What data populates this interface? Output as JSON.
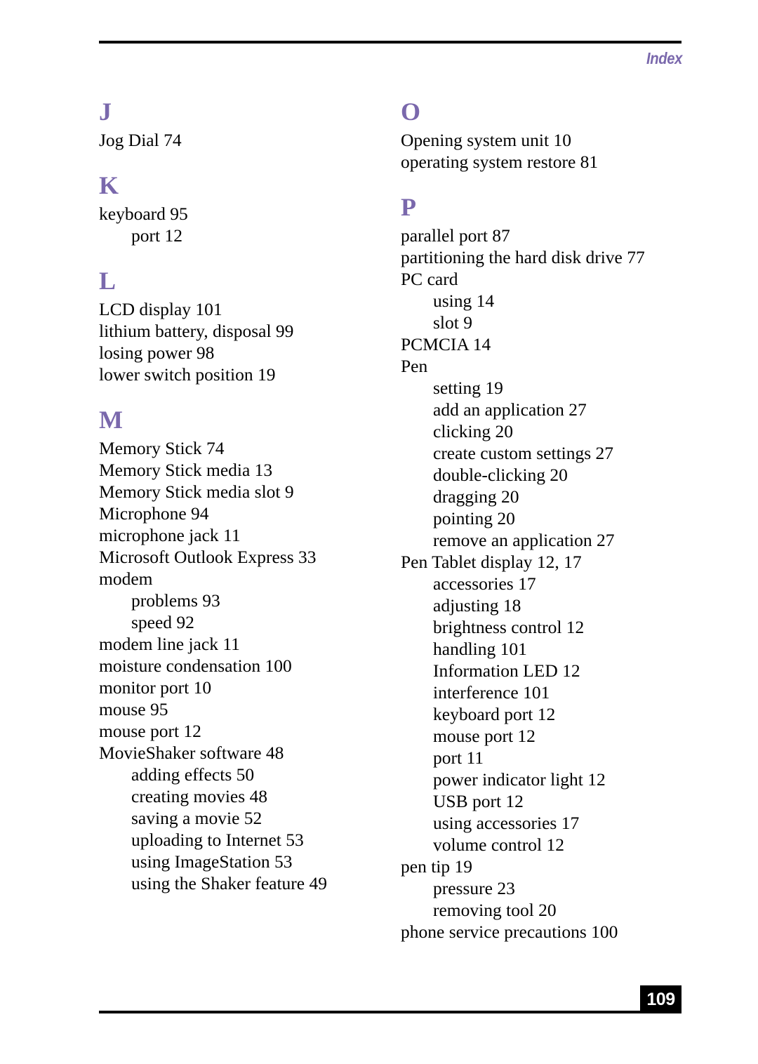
{
  "header": {
    "label": "Index"
  },
  "footer": {
    "page_number": "109"
  },
  "colors": {
    "accent_purple": "#7a68ac",
    "rule_black": "#000000",
    "page_box_background": "#000000",
    "page_number_text": "#ffffff"
  },
  "columns": [
    {
      "id": "left-column",
      "sections": [
        {
          "letter": "J",
          "entries": [
            {
              "text": "Jog Dial 74",
              "level": 1
            }
          ]
        },
        {
          "letter": "K",
          "entries": [
            {
              "text": "keyboard 95",
              "level": 1
            },
            {
              "text": "port 12",
              "level": 2
            }
          ]
        },
        {
          "letter": "L",
          "entries": [
            {
              "text": "LCD display 101",
              "level": 1
            },
            {
              "text": "lithium battery, disposal 99",
              "level": 1
            },
            {
              "text": "losing power 98",
              "level": 1
            },
            {
              "text": "lower switch position 19",
              "level": 1
            }
          ]
        },
        {
          "letter": "M",
          "entries": [
            {
              "text": "Memory Stick 74",
              "level": 1
            },
            {
              "text": "Memory Stick media 13",
              "level": 1
            },
            {
              "text": "Memory Stick media slot 9",
              "level": 1
            },
            {
              "text": "Microphone 94",
              "level": 1
            },
            {
              "text": "microphone jack 11",
              "level": 1
            },
            {
              "text": "Microsoft Outlook Express 33",
              "level": 1
            },
            {
              "text": "modem",
              "level": 1
            },
            {
              "text": "problems 93",
              "level": 2
            },
            {
              "text": "speed 92",
              "level": 2
            },
            {
              "text": "modem line jack 11",
              "level": 1
            },
            {
              "text": "moisture condensation 100",
              "level": 1
            },
            {
              "text": "monitor port 10",
              "level": 1
            },
            {
              "text": "mouse 95",
              "level": 1
            },
            {
              "text": "mouse port 12",
              "level": 1
            },
            {
              "text": "MovieShaker software 48",
              "level": 1
            },
            {
              "text": "adding effects 50",
              "level": 2
            },
            {
              "text": "creating movies 48",
              "level": 2
            },
            {
              "text": "saving a movie 52",
              "level": 2
            },
            {
              "text": "uploading to Internet 53",
              "level": 2
            },
            {
              "text": "using ImageStation 53",
              "level": 2
            },
            {
              "text": "using the Shaker feature 49",
              "level": 2
            }
          ]
        }
      ]
    },
    {
      "id": "right-column",
      "sections": [
        {
          "letter": "O",
          "entries": [
            {
              "text": "Opening system unit 10",
              "level": 1
            },
            {
              "text": "operating system restore 81",
              "level": 1
            }
          ]
        },
        {
          "letter": "P",
          "entries": [
            {
              "text": "parallel port 87",
              "level": 1
            },
            {
              "text": "partitioning the hard disk drive 77",
              "level": 1
            },
            {
              "text": "PC card",
              "level": 1
            },
            {
              "text": "using 14",
              "level": 2
            },
            {
              "text": "slot 9",
              "level": 2
            },
            {
              "text": "PCMCIA 14",
              "level": 1
            },
            {
              "text": "Pen",
              "level": 1
            },
            {
              "text": "setting 19",
              "level": 2
            },
            {
              "text": "add an application 27",
              "level": 2
            },
            {
              "text": "clicking 20",
              "level": 2
            },
            {
              "text": "create custom settings 27",
              "level": 2
            },
            {
              "text": "double-clicking 20",
              "level": 2
            },
            {
              "text": "dragging 20",
              "level": 2
            },
            {
              "text": "pointing 20",
              "level": 2
            },
            {
              "text": "remove an application 27",
              "level": 2
            },
            {
              "text": "Pen Tablet display 12, 17",
              "level": 1
            },
            {
              "text": "accessories 17",
              "level": 2
            },
            {
              "text": "adjusting 18",
              "level": 2
            },
            {
              "text": "brightness control 12",
              "level": 2
            },
            {
              "text": "handling 101",
              "level": 2
            },
            {
              "text": "Information LED 12",
              "level": 2
            },
            {
              "text": "interference 101",
              "level": 2
            },
            {
              "text": "keyboard port 12",
              "level": 2
            },
            {
              "text": "mouse port 12",
              "level": 2
            },
            {
              "text": "port 11",
              "level": 2
            },
            {
              "text": "power indicator light 12",
              "level": 2
            },
            {
              "text": "USB port 12",
              "level": 2
            },
            {
              "text": "using accessories 17",
              "level": 2
            },
            {
              "text": "volume control 12",
              "level": 2
            },
            {
              "text": "pen tip 19",
              "level": 1
            },
            {
              "text": "pressure 23",
              "level": 2
            },
            {
              "text": "removing tool 20",
              "level": 2
            },
            {
              "text": "phone service precautions 100",
              "level": 1
            }
          ]
        }
      ]
    }
  ]
}
